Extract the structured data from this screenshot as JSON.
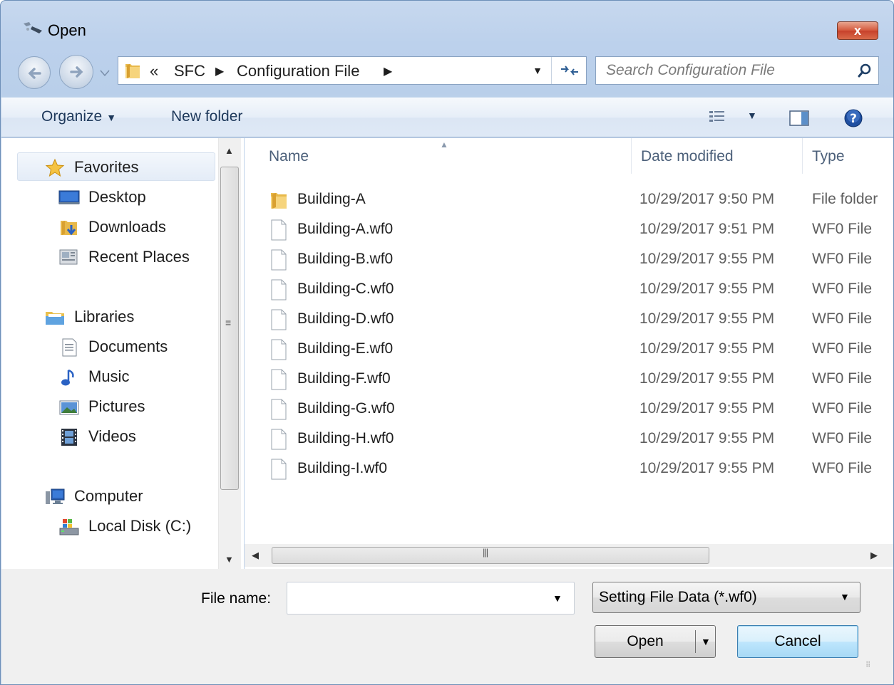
{
  "window": {
    "title": "Open",
    "close_label": "x"
  },
  "navigation": {
    "breadcrumb": [
      "«",
      "SFC",
      "Configuration File"
    ],
    "search_placeholder": "Search Configuration File"
  },
  "toolbar": {
    "organize_label": "Organize",
    "new_folder_label": "New folder"
  },
  "sidebar": {
    "items": [
      {
        "label": "Favorites",
        "icon": "star-icon"
      },
      {
        "label": "Desktop",
        "icon": "desktop-icon"
      },
      {
        "label": "Downloads",
        "icon": "downloads-icon"
      },
      {
        "label": "Recent Places",
        "icon": "recent-places-icon"
      },
      {
        "label": "Libraries",
        "icon": "libraries-icon"
      },
      {
        "label": "Documents",
        "icon": "documents-icon"
      },
      {
        "label": "Music",
        "icon": "music-icon"
      },
      {
        "label": "Pictures",
        "icon": "pictures-icon"
      },
      {
        "label": "Videos",
        "icon": "videos-icon"
      },
      {
        "label": "Computer",
        "icon": "computer-icon"
      },
      {
        "label": "Local Disk (C:)",
        "icon": "local-disk-icon"
      }
    ],
    "selected": "Favorites"
  },
  "file_list": {
    "columns": [
      "Name",
      "Date modified",
      "Type"
    ],
    "sorted_by": "Name",
    "rows": [
      {
        "name": "Building-A",
        "date": "10/29/2017 9:50 PM",
        "type": "File folder",
        "icon": "folder-icon"
      },
      {
        "name": "Building-A.wf0",
        "date": "10/29/2017 9:51 PM",
        "type": "WF0 File",
        "icon": "file-icon"
      },
      {
        "name": "Building-B.wf0",
        "date": "10/29/2017 9:55 PM",
        "type": "WF0 File",
        "icon": "file-icon"
      },
      {
        "name": "Building-C.wf0",
        "date": "10/29/2017 9:55 PM",
        "type": "WF0 File",
        "icon": "file-icon"
      },
      {
        "name": "Building-D.wf0",
        "date": "10/29/2017 9:55 PM",
        "type": "WF0 File",
        "icon": "file-icon"
      },
      {
        "name": "Building-E.wf0",
        "date": "10/29/2017 9:55 PM",
        "type": "WF0 File",
        "icon": "file-icon"
      },
      {
        "name": "Building-F.wf0",
        "date": "10/29/2017 9:55 PM",
        "type": "WF0 File",
        "icon": "file-icon"
      },
      {
        "name": "Building-G.wf0",
        "date": "10/29/2017 9:55 PM",
        "type": "WF0 File",
        "icon": "file-icon"
      },
      {
        "name": "Building-H.wf0",
        "date": "10/29/2017 9:55 PM",
        "type": "WF0 File",
        "icon": "file-icon"
      },
      {
        "name": "Building-I.wf0",
        "date": "10/29/2017 9:55 PM",
        "type": "WF0 File",
        "icon": "file-icon"
      }
    ]
  },
  "footer": {
    "file_name_label": "File name:",
    "file_name_value": "",
    "file_type_value": "Setting File Data (*.wf0)",
    "open_label": "Open",
    "cancel_label": "Cancel"
  },
  "colors": {
    "frame": "#bcd1ec",
    "accent": "#3c7fb1",
    "close_button": "#c7412b"
  }
}
